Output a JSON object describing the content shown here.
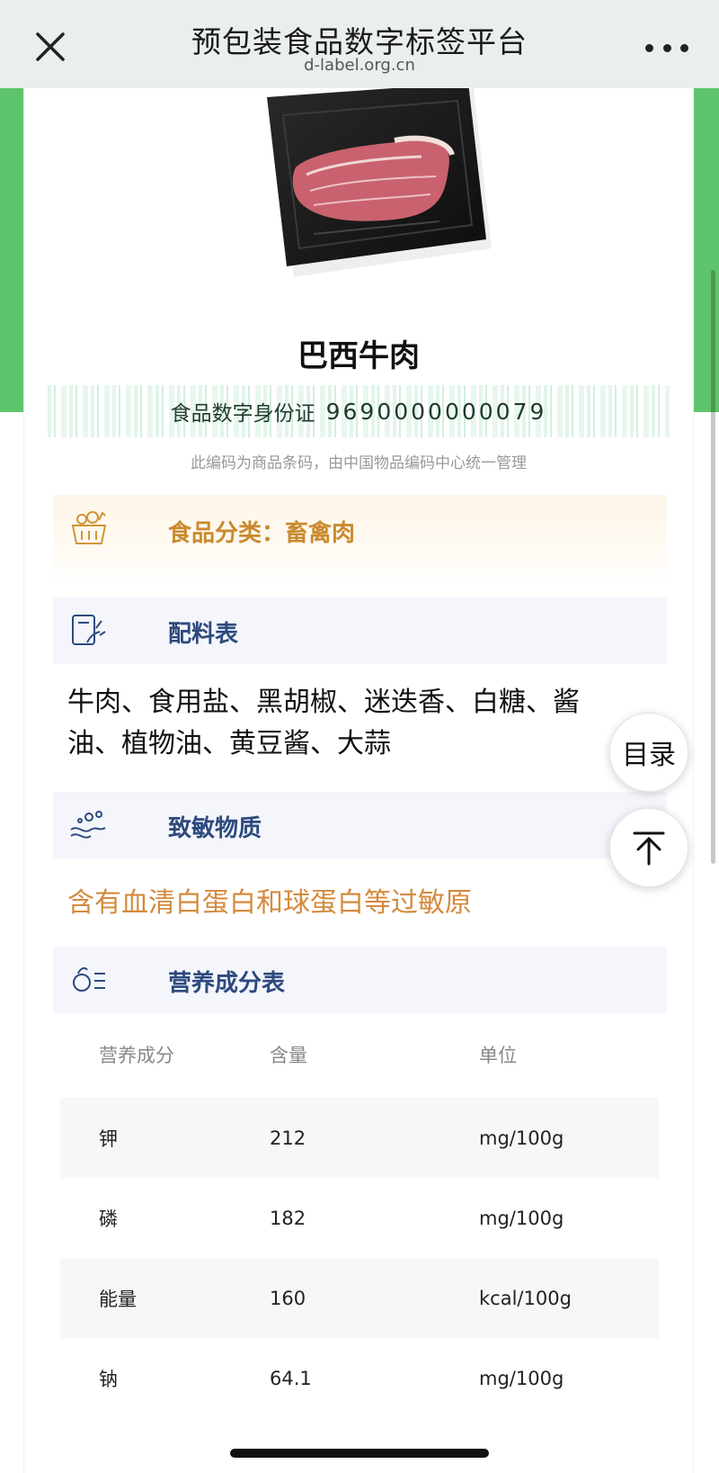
{
  "topbar": {
    "title": "预包装食品数字标签平台",
    "url": "d-label.org.cn",
    "close_icon": "close-icon",
    "more_icon": "more-icon"
  },
  "product": {
    "name": "巴西牛肉",
    "image_icon": "packaged-beef-image",
    "id_label": "食品数字身份证",
    "id_value": "9690000000079",
    "id_note": "此编码为商品条码，由中国物品编码中心统一管理"
  },
  "category": {
    "text": "食品分类：畜禽肉",
    "icon": "food-basket-icon"
  },
  "sections": {
    "ingredients": {
      "title": "配料表",
      "icon": "ingredients-icon",
      "text": "牛肉、食用盐、黑胡椒、迷迭香、白糖、酱油、植物油、黄豆酱、大蒜"
    },
    "allergens": {
      "title": "致敏物质",
      "icon": "allergen-icon",
      "text": "含有血清白蛋白和球蛋白等过敏原"
    },
    "nutrition": {
      "title": "营养成分表",
      "icon": "nutrition-icon"
    }
  },
  "nutrition_table": {
    "headers": [
      "营养成分",
      "含量",
      "单位"
    ],
    "rows": [
      [
        "钾",
        "212",
        "mg/100g"
      ],
      [
        "磷",
        "182",
        "mg/100g"
      ],
      [
        "能量",
        "160",
        "kcal/100g"
      ],
      [
        "钠",
        "64.1",
        "mg/100g"
      ]
    ]
  },
  "floating": {
    "toc_label": "目录",
    "top_icon": "back-to-top-icon"
  },
  "colors": {
    "topbar_bg": "#eaefeb",
    "green_accent": "#5ec46c",
    "category_text": "#c98a2e",
    "section_title": "#2e4a7d",
    "allergen_text": "#d48a3c"
  }
}
